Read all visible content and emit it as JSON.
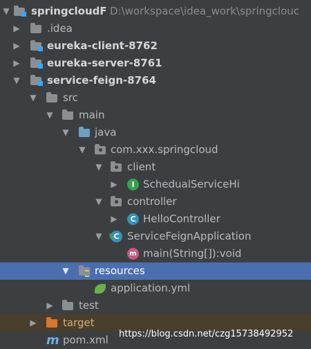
{
  "tree": {
    "root": {
      "name": "springcloudF",
      "path": "D:\\workspace\\idea_work\\springclouc"
    },
    "idea": ".idea",
    "eureka_client": "eureka-client-8762",
    "eureka_server": "eureka-server-8761",
    "service_feign": "service-feign-8764",
    "src": "src",
    "main": "main",
    "java": "java",
    "package": "com.xxx.springcloud",
    "client_pkg": "client",
    "schedual_service": "SchedualServiceHi",
    "controller_pkg": "controller",
    "hello_controller": "HelloController",
    "app_class": "ServiceFeignApplication",
    "main_method": "main(String[]):void",
    "resources": "resources",
    "application_yml": "application.yml",
    "test": "test",
    "target": "target",
    "pom": "pom.xml"
  },
  "icons": {
    "interface_letter": "I",
    "class_letter": "C",
    "method_letter": "m",
    "maven_letter": "m"
  },
  "watermark": "https://blog.csdn.net/czg15738492952"
}
